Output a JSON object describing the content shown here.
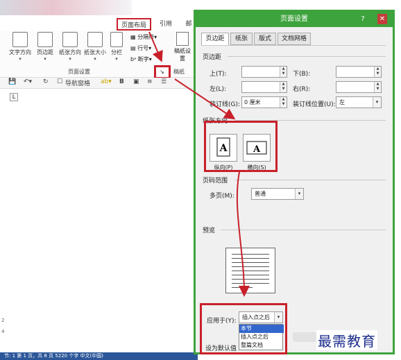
{
  "ribbon": {
    "tabs": [
      "页面布局",
      "引用",
      "邮"
    ],
    "buttons": [
      "文字方向",
      "页边距",
      "纸张方向",
      "纸张大小",
      "分栏"
    ],
    "small_buttons": [
      "分隔符",
      "行号",
      "断字"
    ],
    "draft_label": "稿纸设置",
    "group_label": "页面设置",
    "draft_group": "稿纸"
  },
  "qat": {
    "nav_pane_label": "导航窗格"
  },
  "status": {
    "text": "节: 1   第 1 页，共 8 页   5220 个字   中文(中国)"
  },
  "dialog": {
    "title": "页面设置",
    "help": "?",
    "close": "✕",
    "tabs": [
      "页边距",
      "纸张",
      "版式",
      "文档网格"
    ],
    "margins_section": "页边距",
    "top_label": "上(T):",
    "bottom_label": "下(B):",
    "left_label": "左(L):",
    "right_label": "右(R):",
    "gutter_label": "装订线(G):",
    "gutter_value": "0 厘米",
    "gutter_pos_label": "装订线位置(U):",
    "gutter_pos_value": "左",
    "orientation_section": "纸张方向",
    "portrait_label": "纵向(P)",
    "landscape_label": "横向(S)",
    "pages_section": "页码范围",
    "multi_pages_label": "多页(M):",
    "multi_pages_value": "普通",
    "preview_section": "预览",
    "apply_label": "应用于(Y):",
    "apply_value": "插入点之后",
    "apply_options": [
      "本节",
      "插入点之后",
      "整篇文档"
    ],
    "set_default": "设为默认值"
  },
  "watermark": "最需教育",
  "colors": {
    "dialog_border": "#3da33d",
    "highlight": "#c8202a",
    "selection": "#3366cc"
  }
}
